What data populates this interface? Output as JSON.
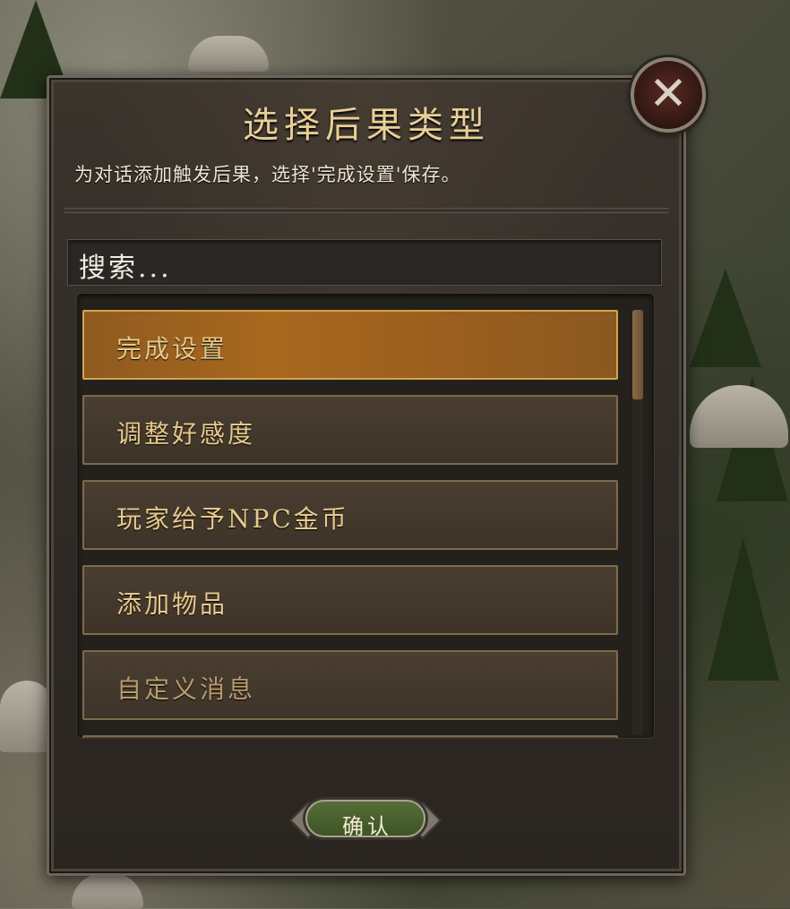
{
  "dialog": {
    "title": "选择后果类型",
    "subtitle": "为对话添加触发后果，选择'完成设置'保存。"
  },
  "search": {
    "placeholder": "搜索..."
  },
  "list": {
    "items": [
      {
        "label": "完成设置",
        "selected": true
      },
      {
        "label": "调整好感度",
        "selected": false
      },
      {
        "label": "玩家给予NPC金币",
        "selected": false
      },
      {
        "label": "添加物品",
        "selected": false
      },
      {
        "label": "自定义消息",
        "selected": false
      }
    ]
  },
  "buttons": {
    "confirm_label": "确认",
    "close_icon": "close-x-icon"
  },
  "colors": {
    "accent_gold": "#e9cf97",
    "selected_orange": "#a8681f",
    "confirm_green": "#566e38"
  }
}
